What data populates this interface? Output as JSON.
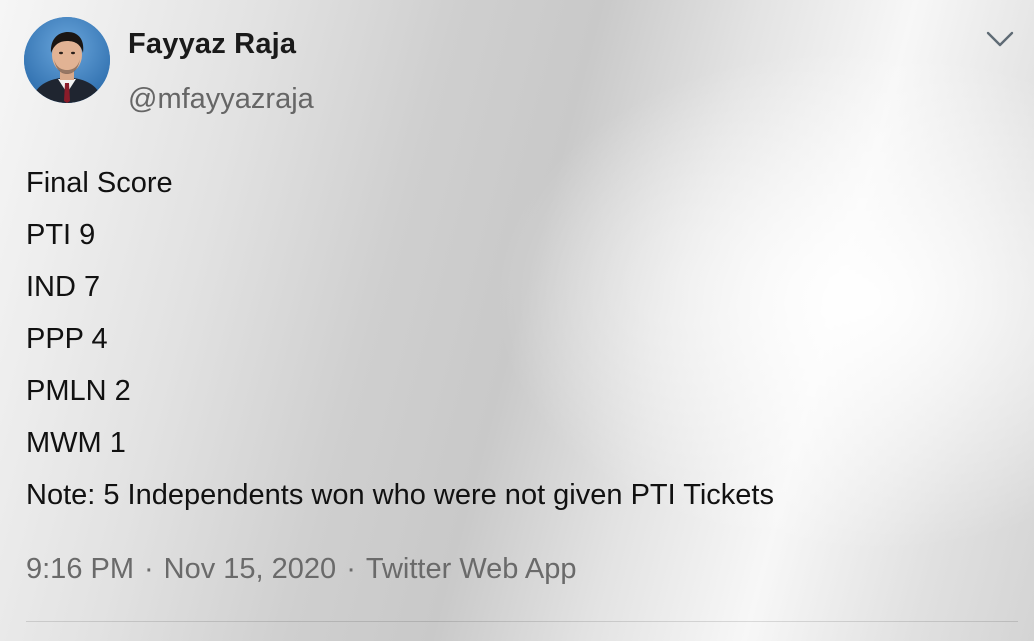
{
  "tweet": {
    "author": {
      "display_name": "Fayyaz Raja",
      "handle": "@mfayyazraja",
      "avatar": "profile-photo"
    },
    "menu_icon": "chevron-down-icon",
    "lines": [
      "Final Score",
      "PTI 9",
      "IND 7",
      "PPP 4",
      "PMLN 2",
      "MWM 1",
      "Note: 5 Independents won who were not given PTI Tickets"
    ],
    "time": "9:16 PM",
    "date": "Nov 15, 2020",
    "source": "Twitter Web App",
    "separator": "·"
  },
  "colors": {
    "name": "#1a1a1a",
    "secondary": "#6a6a6a",
    "avatar_bg": "#3f84c6"
  }
}
